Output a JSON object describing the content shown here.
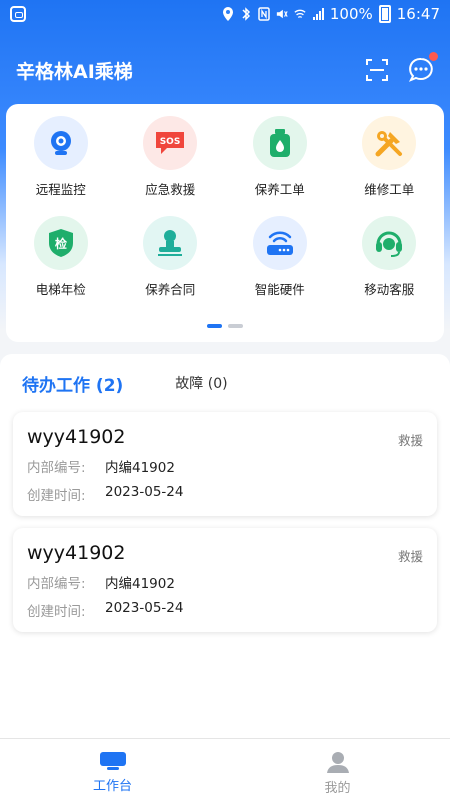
{
  "status_bar": {
    "battery": "100%",
    "time": "16:47"
  },
  "header": {
    "title": "辛格林AI乘梯"
  },
  "grid": [
    {
      "label": "远程监控",
      "icon": "camera-icon",
      "color": "#1f74f3"
    },
    {
      "label": "应急救援",
      "icon": "sos-icon",
      "color": "#f0463c"
    },
    {
      "label": "保养工单",
      "icon": "oil-can-icon",
      "color": "#1fae6b"
    },
    {
      "label": "维修工单",
      "icon": "tools-icon",
      "color": "#f5a623"
    },
    {
      "label": "电梯年检",
      "icon": "inspection-shield-icon",
      "color": "#1fae6b"
    },
    {
      "label": "保养合同",
      "icon": "stamp-icon",
      "color": "#1fae9a"
    },
    {
      "label": "智能硬件",
      "icon": "router-icon",
      "color": "#1f74f3"
    },
    {
      "label": "移动客服",
      "icon": "headset-icon",
      "color": "#1fae6b"
    }
  ],
  "tabs": {
    "pending": "待办工作 (2)",
    "fault": "故障 (0)"
  },
  "tasks": [
    {
      "code": "wyy41902",
      "type": "救援",
      "internal_label": "内部编号:",
      "internal_value": "内编41902",
      "created_label": "创建时间:",
      "created_value": "2023-05-24"
    },
    {
      "code": "wyy41902",
      "type": "救援",
      "internal_label": "内部编号:",
      "internal_value": "内编41902",
      "created_label": "创建时间:",
      "created_value": "2023-05-24"
    }
  ],
  "bottom_nav": {
    "workbench": "工作台",
    "mine": "我的"
  },
  "colors": {
    "accent": "#1f74f3",
    "inactive": "#9a9a9a"
  }
}
